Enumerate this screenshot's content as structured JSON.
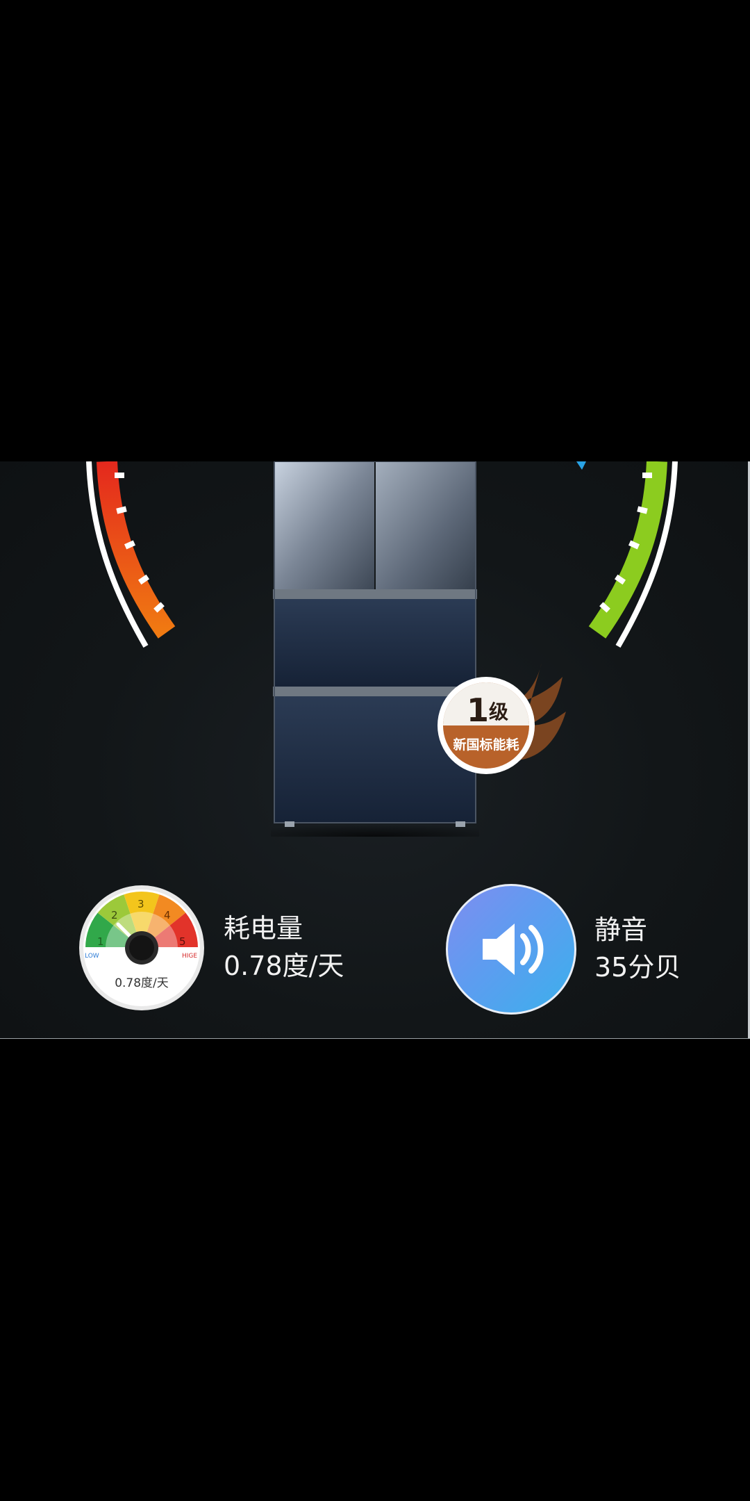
{
  "badge": {
    "rank": "1",
    "rank_suffix": "级",
    "subtitle": "新国标能耗"
  },
  "energy": {
    "icon": "energy-gauge-icon",
    "gauge_scale": [
      "1",
      "2",
      "3",
      "4",
      "5"
    ],
    "gauge_low_label": "LOW",
    "gauge_high_label": "HIGE",
    "gauge_caption": "0.78度/天",
    "title": "耗电量",
    "value": "0.78度/天"
  },
  "noise": {
    "icon": "speaker-icon",
    "title": "静音",
    "value": "35分贝"
  },
  "colors": {
    "background": "#121618",
    "arc_left_top": "#e4281d",
    "arc_left_bottom": "#f07a12",
    "arc_right": "#8ccc1f",
    "speaker_start": "#7f8df0",
    "speaker_end": "#3bb0ec",
    "badge": "#b8622a"
  }
}
